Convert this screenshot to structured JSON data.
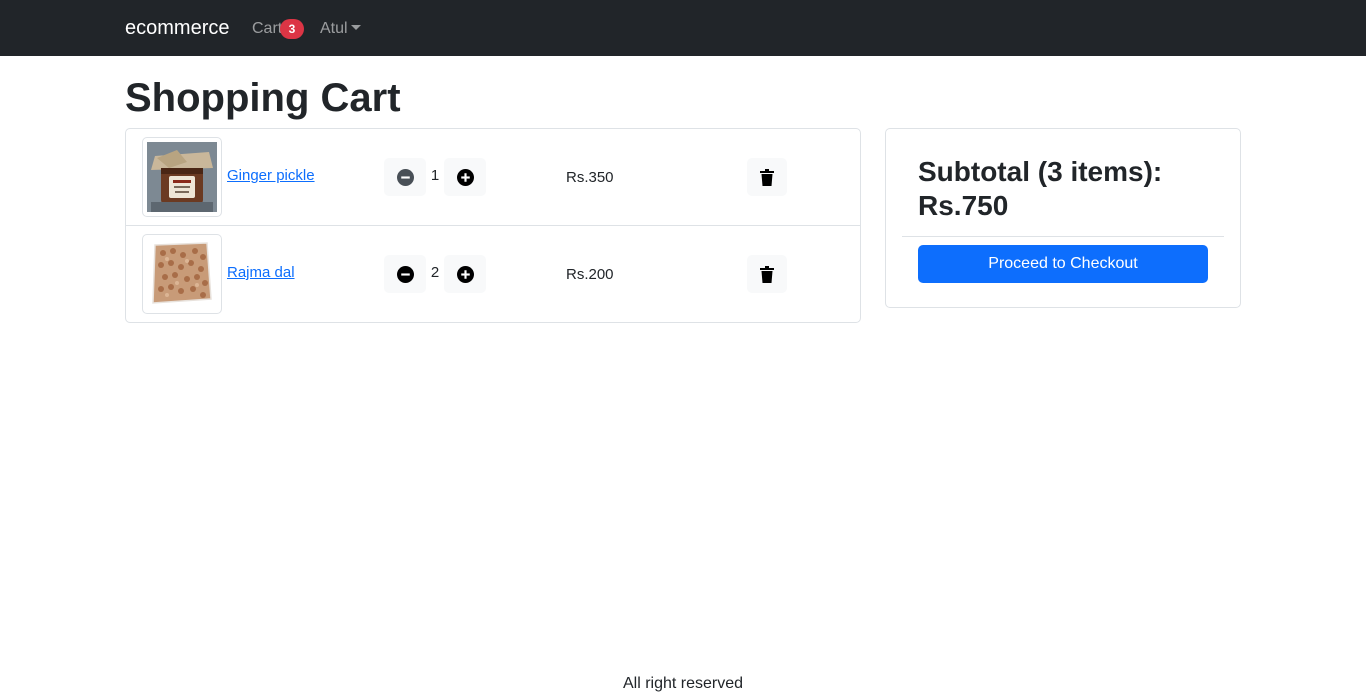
{
  "navbar": {
    "brand": "ecommerce",
    "cart_label": "Cart",
    "cart_count": "3",
    "user_name": "Atul"
  },
  "page": {
    "title": "Shopping Cart"
  },
  "cart_items": [
    {
      "name": "Ginger pickle",
      "quantity": "1",
      "price": "Rs.350"
    },
    {
      "name": "Rajma dal",
      "quantity": "2",
      "price": "Rs.200"
    }
  ],
  "summary": {
    "subtotal_label": "Subtotal (3 items):",
    "subtotal_amount": "Rs.750",
    "checkout_label": "Proceed to Checkout"
  },
  "footer": {
    "text": "All right reserved"
  },
  "colors": {
    "navbar": "#212529",
    "accent": "#0d6efd",
    "badge": "#dc3545"
  },
  "icons": {
    "decrease": "minus-circle-icon",
    "increase": "plus-circle-icon",
    "delete": "trash-icon"
  }
}
